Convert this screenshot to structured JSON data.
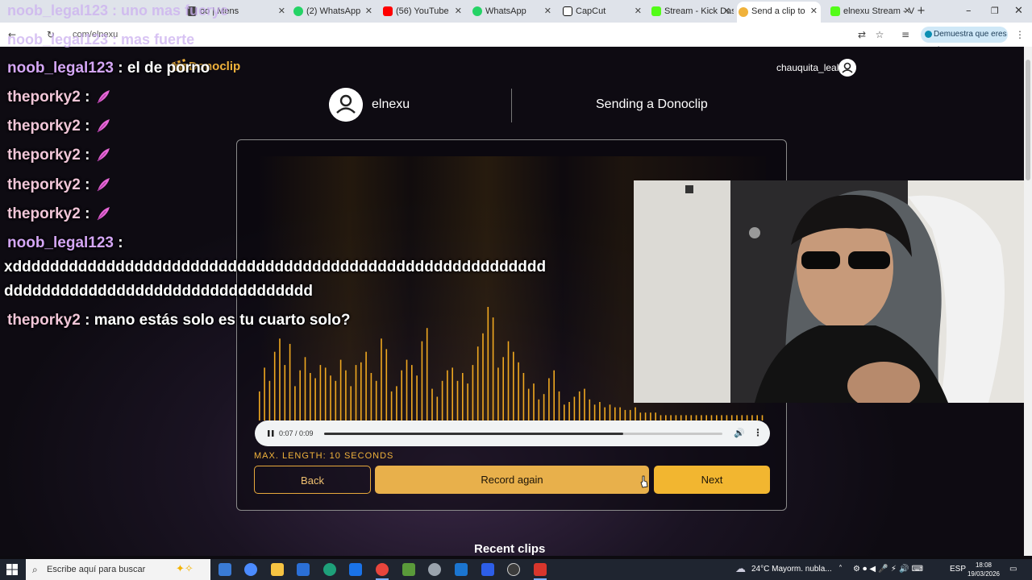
{
  "browser": {
    "tabs": [
      {
        "label": "oo | Mens",
        "color": "#444444"
      },
      {
        "label": "(2) WhatsApp",
        "color": "#25d366"
      },
      {
        "label": "(56) YouTube",
        "color": "#ff0000"
      },
      {
        "label": "WhatsApp",
        "color": "#25d366"
      },
      {
        "label": "CapCut",
        "color": "#111111"
      },
      {
        "label": "Stream - Kick Das",
        "color": "#53fc18"
      },
      {
        "label": "Send a clip to",
        "color": "#f0b23b"
      },
      {
        "label": "elnexu Stream - V",
        "color": "#53fc18"
      }
    ],
    "url": "com/elnexu",
    "verify_label": "Demuestra que eres tú"
  },
  "page": {
    "logo": "Donoclip",
    "current_user": "chauquita_leal",
    "streamer": "elnexu",
    "heading": "Sending a Donoclip",
    "max_length": "MAX. LENGTH: 10 SECONDS",
    "buttons": {
      "back": "Back",
      "record_again": "Record again",
      "next": "Next"
    },
    "recent_clips": "Recent clips",
    "player": {
      "time": "0:07 / 0:09",
      "progress": 0.75,
      "visualizer_levels": [
        0.11,
        0.2,
        0.15,
        0.26,
        0.31,
        0.21,
        0.29,
        0.13,
        0.19,
        0.24,
        0.18,
        0.16,
        0.21,
        0.2,
        0.17,
        0.15,
        0.23,
        0.19,
        0.13,
        0.21,
        0.22,
        0.26,
        0.18,
        0.15,
        0.31,
        0.27,
        0.11,
        0.13,
        0.19,
        0.23,
        0.21,
        0.17,
        0.3,
        0.35,
        0.12,
        0.09,
        0.15,
        0.19,
        0.2,
        0.15,
        0.18,
        0.14,
        0.21,
        0.28,
        0.33,
        0.43,
        0.39,
        0.2,
        0.24,
        0.3,
        0.26,
        0.22,
        0.18,
        0.12,
        0.14,
        0.08,
        0.1,
        0.16,
        0.19,
        0.11,
        0.06,
        0.07,
        0.09,
        0.11,
        0.12,
        0.08,
        0.06,
        0.07,
        0.05,
        0.06,
        0.05,
        0.05,
        0.04,
        0.04,
        0.05,
        0.03,
        0.03,
        0.03,
        0.03,
        0.02,
        0.02,
        0.02,
        0.02,
        0.02,
        0.02,
        0.02,
        0.02,
        0.02,
        0.02,
        0.02,
        0.02,
        0.02,
        0.02,
        0.02,
        0.02,
        0.02,
        0.02,
        0.02,
        0.02,
        0.02
      ]
    }
  },
  "chat": {
    "ghost_lines": [
      "noob_legal123 : uno mas fuerye",
      "noob_legal123 : mas fuerte"
    ],
    "messages": [
      {
        "user": "noob_legal123",
        "sep": " : ",
        "text": "el de porno",
        "emote": false
      },
      {
        "user": "theporky2",
        "sep": " :",
        "text": "",
        "emote": true
      },
      {
        "user": "theporky2",
        "sep": " :",
        "text": "",
        "emote": true
      },
      {
        "user": "theporky2",
        "sep": " :",
        "text": "",
        "emote": true
      },
      {
        "user": "theporky2",
        "sep": " :",
        "text": "",
        "emote": true
      },
      {
        "user": "theporky2",
        "sep": " :",
        "text": "",
        "emote": true
      },
      {
        "user": "noob_legal123",
        "sep": " :",
        "text": "",
        "emote": false
      }
    ],
    "long_line_1": "xddddddddddddddddddddddddddddddddddddddddddddddddddddddddd",
    "long_line_2": "ddddddddddddddddddddddddddddddddd",
    "last": {
      "user": "theporky2",
      "sep": " : ",
      "text": "mano estás solo es tu cuarto solo?"
    }
  },
  "taskbar": {
    "search_placeholder": "Escribe aquí para buscar",
    "weather": "24°C  Mayorm. nubla...",
    "lang": "ESP",
    "time": "18:08",
    "date": "19/03/2026"
  }
}
